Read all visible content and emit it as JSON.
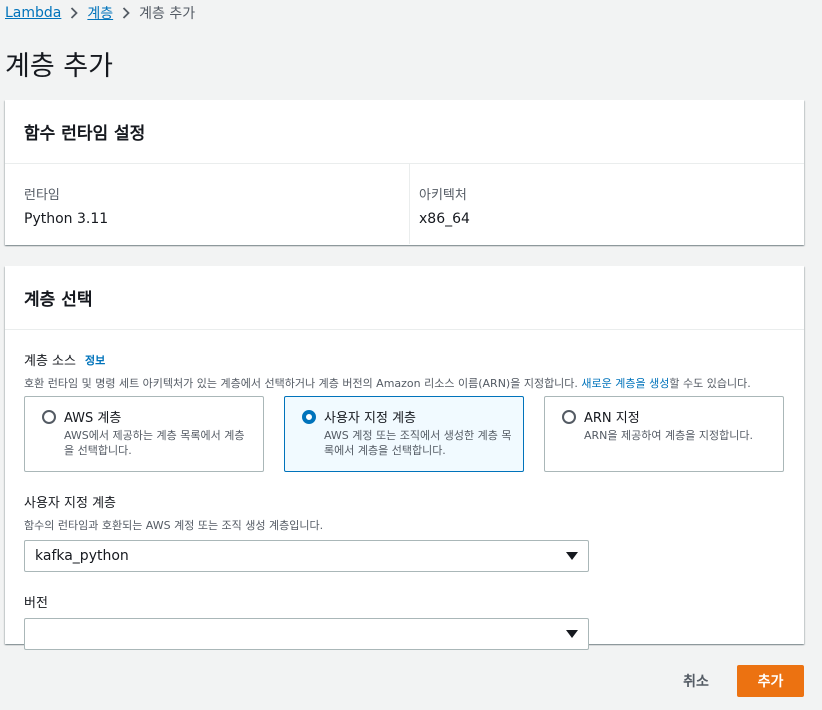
{
  "breadcrumb": {
    "items": [
      "Lambda",
      "계층"
    ],
    "current": "계층 추가"
  },
  "page": {
    "title": "계층 추가"
  },
  "runtime_panel": {
    "title": "함수 런타임 설정",
    "runtime_label": "런타임",
    "runtime_value": "Python 3.11",
    "arch_label": "아키텍처",
    "arch_value": "x86_64"
  },
  "layer_panel": {
    "title": "계층 선택",
    "source": {
      "label": "계층 소스",
      "info": "정보",
      "desc_before": "호환 런타임 및 명령 세트 아키텍처가 있는 계층에서 선택하거나 계층 버전의 Amazon 리소스 이름(ARN)을 지정합니다. ",
      "desc_link": "새로운 계층을 생성",
      "desc_after": "할 수도 있습니다."
    },
    "tiles": [
      {
        "label": "AWS 계층",
        "desc": "AWS에서 제공하는 계층 목록에서 계층을 선택합니다.",
        "selected": false
      },
      {
        "label": "사용자 지정 계층",
        "desc": "AWS 계정 또는 조직에서 생성한 계층 목록에서 계층을 선택합니다.",
        "selected": true
      },
      {
        "label": "ARN 지정",
        "desc": "ARN을 제공하여 계층을 지정합니다.",
        "selected": false
      }
    ],
    "custom_layer": {
      "label": "사용자 지정 계층",
      "desc": "함수의 런타임과 호환되는 AWS 계정 또는 조직 생성 계층입니다.",
      "value": "kafka_python"
    },
    "version": {
      "label": "버전",
      "value": ""
    }
  },
  "footer": {
    "cancel_label": "취소",
    "add_label": "추가"
  },
  "colors": {
    "link": "#0073bb",
    "primary": "#ec7211",
    "selected_tile_bg": "#f1faff"
  }
}
